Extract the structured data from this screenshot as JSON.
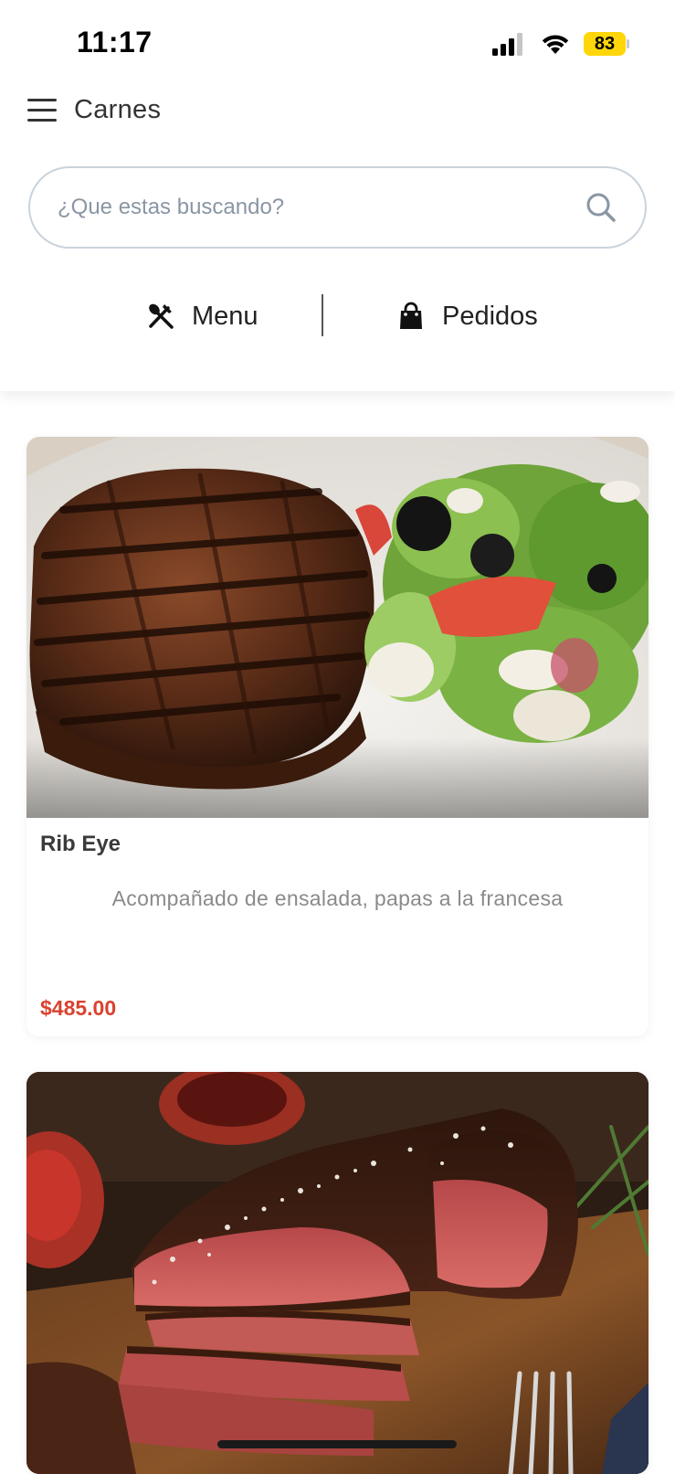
{
  "status_bar": {
    "time": "11:17",
    "battery": "83",
    "icons": [
      "signal-icon",
      "wifi-icon",
      "battery-icon"
    ]
  },
  "header": {
    "title": "Carnes",
    "menu_icon": "hamburger-icon"
  },
  "search": {
    "placeholder": "¿Que estas buscando?",
    "value": "",
    "icon": "search-icon"
  },
  "tabs": [
    {
      "label": "Menu",
      "icon": "utensils-icon"
    },
    {
      "label": "Pedidos",
      "icon": "shopping-bag-icon"
    }
  ],
  "products": [
    {
      "name": "Rib Eye",
      "description": "Acompañado de ensalada, papas a la francesa",
      "price": "$485.00",
      "image": "grilled-steak-with-salad"
    },
    {
      "image": "sliced-steak-on-board"
    }
  ],
  "colors": {
    "price": "#d9432f",
    "search_border": "#c9d3dc",
    "battery": "#ffd60a"
  }
}
